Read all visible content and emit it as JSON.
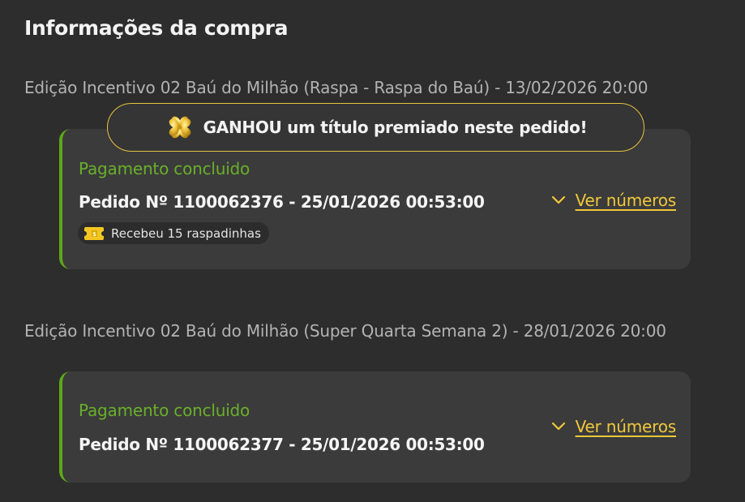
{
  "header": {
    "title": "Informações da compra"
  },
  "orders": [
    {
      "edition": "Edição Incentivo 02 Baú do Milhão (Raspa - Raspa do Baú) - 13/02/2026 20:00",
      "winner_badge": {
        "icon": "clover-icon",
        "label": "GANHOU um título premiado neste pedido!",
        "color": "#e5c23f"
      },
      "status": "Pagamento concluido",
      "order_label": "Pedido Nº 1100062376 - 25/01/2026 00:53:00",
      "view_label": "Ver números",
      "reward": {
        "icon": "ticket-icon",
        "label": "Recebeu 15 raspadinhas"
      }
    },
    {
      "edition": "Edição Incentivo 02 Baú do Milhão (Super Quarta Semana 2) - 28/01/2026 20:00",
      "status": "Pagamento concluido",
      "order_label": "Pedido Nº 1100062377 - 25/01/2026 00:53:00",
      "view_label": "Ver números"
    }
  ],
  "colors": {
    "background": "#2d2d2d",
    "card": "#3b3b3b",
    "success": "#69b02a",
    "accent": "#f0c83a"
  }
}
